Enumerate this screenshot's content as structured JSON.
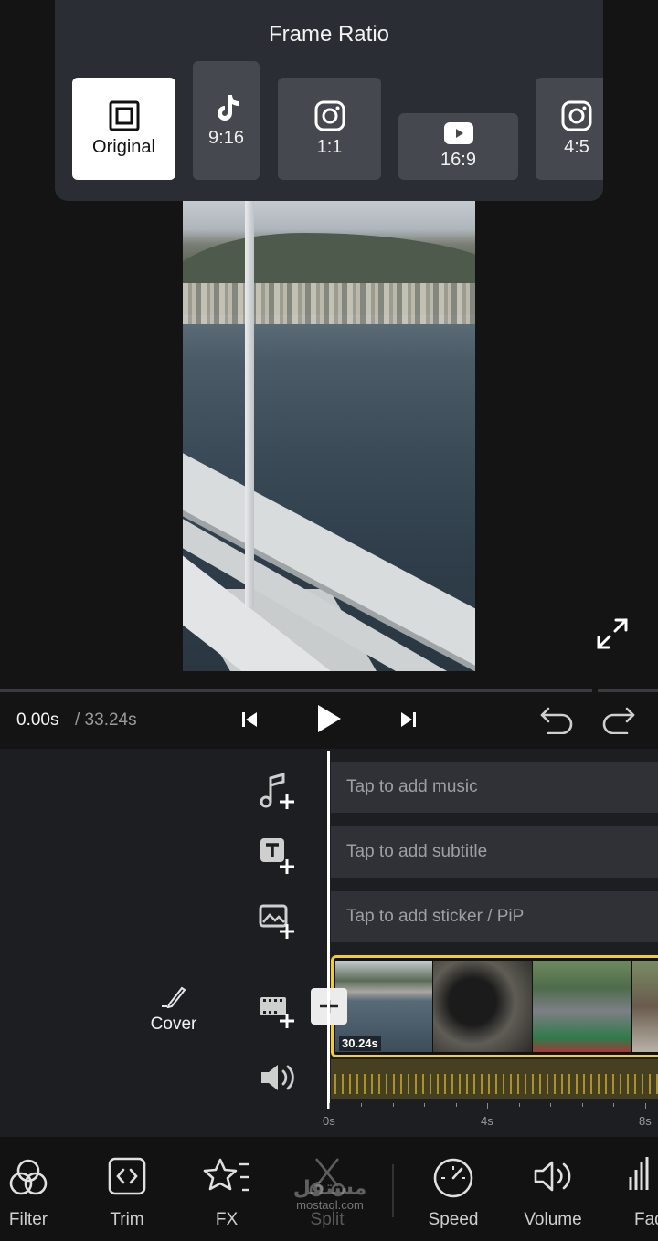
{
  "frame_ratio": {
    "title": "Frame Ratio",
    "options": [
      {
        "label": "Original",
        "icon": "square-frame-icon",
        "selected": true
      },
      {
        "label": "9:16",
        "icon": "tiktok-icon",
        "selected": false
      },
      {
        "label": "1:1",
        "icon": "instagram-icon",
        "selected": false
      },
      {
        "label": "16:9",
        "icon": "youtube-icon",
        "selected": false
      },
      {
        "label": "4:5",
        "icon": "instagram-icon",
        "selected": false
      }
    ]
  },
  "player": {
    "current_time": "0.00s",
    "total_time": "/ 33.24s",
    "icons": [
      "skip-start-icon",
      "play-icon",
      "skip-end-icon",
      "undo-icon",
      "redo-icon",
      "fullscreen-icon"
    ]
  },
  "tracks": {
    "music": "Tap to add music",
    "subtitle": "Tap to add subtitle",
    "sticker": "Tap to add sticker / PiP"
  },
  "clip": {
    "duration": "30.24s",
    "cover_label": "Cover"
  },
  "ruler": {
    "labels": [
      "0s",
      "4s",
      "8s"
    ]
  },
  "toolbar": {
    "items": [
      {
        "label": "Filter",
        "icon": "filter-icon",
        "enabled": true
      },
      {
        "label": "Trim",
        "icon": "trim-icon",
        "enabled": true
      },
      {
        "label": "FX",
        "icon": "fx-icon",
        "enabled": true
      },
      {
        "label": "Split",
        "icon": "scissors-icon",
        "enabled": false
      },
      {
        "label": "Speed",
        "icon": "speed-icon",
        "enabled": true
      },
      {
        "label": "Volume",
        "icon": "volume-icon",
        "enabled": true
      },
      {
        "label": "Fad",
        "icon": "fade-icon",
        "enabled": true
      }
    ]
  },
  "watermark": {
    "text": "مستقل",
    "url": "mostaql.com"
  },
  "colors": {
    "accent_clip_border": "#f2cf2f",
    "panel_bg": "#2a2d33",
    "track_bg": "#2f3136"
  }
}
